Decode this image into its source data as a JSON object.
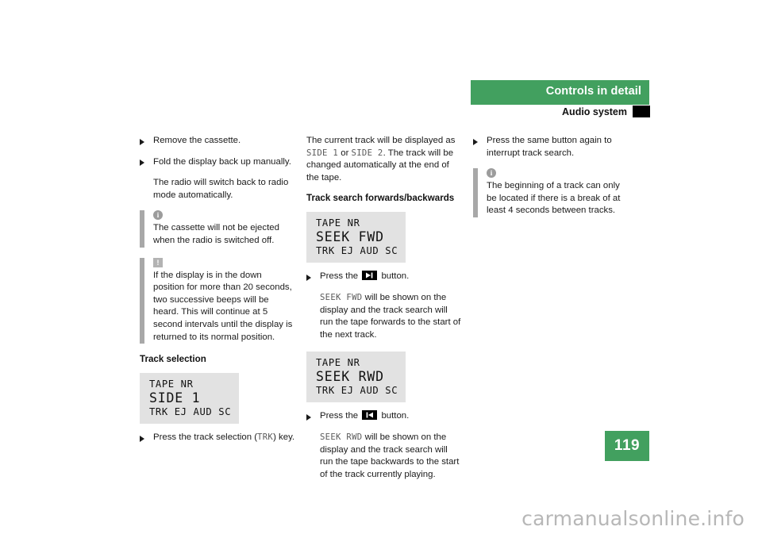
{
  "header": {
    "title": "Controls in detail",
    "subtitle": "Audio system",
    "band_color": "#42a05f",
    "tab_color": "#000000"
  },
  "page_number": "119",
  "watermark": "carmanualsonline.info",
  "columns": {
    "left": {
      "bullets": [
        "Remove the cassette.",
        "Fold the display back up manually."
      ],
      "indent_paragraph": "The radio will switch back to radio mode automatically.",
      "notes": [
        {
          "icon": "info-icon",
          "glyph": "i",
          "text": "The cassette will not be ejected when the radio is switched off."
        },
        {
          "icon": "warning-icon",
          "glyph": "!",
          "text": "If the display is in the down position for more than 20 seconds, two successive beeps will be heard. This will continue at 5 second intervals until the display is returned to its normal position."
        }
      ],
      "section_heading": "Track selection",
      "display": {
        "line1": "TAPE NR",
        "line2": "SIDE 1",
        "line3": "TRK EJ AUD SC"
      },
      "bullet_after_display": {
        "pre": "Press the track selection (",
        "mono": "TRK",
        "post": ") key."
      }
    },
    "middle": {
      "intro": {
        "part1": "The current track will be displayed as ",
        "mono1": "SIDE 1",
        "part2": " or ",
        "mono2": "SIDE 2",
        "part3": ". The track will be changed automatically at the end of the tape."
      },
      "section_heading": "Track search forwards/backwards",
      "fwd": {
        "display": {
          "line1": "TAPE NR",
          "line2": "SEEK FWD",
          "line3": "TRK EJ AUD SC"
        },
        "bullet_pre": "Press the ",
        "button_icon": "skip-forward-icon",
        "bullet_post": " button.",
        "body_mono": "SEEK FWD",
        "body_text": " will be shown on the display and the track search will run the tape forwards to the start of the next track."
      },
      "rwd": {
        "display": {
          "line1": "TAPE NR",
          "line2": "SEEK RWD",
          "line3": "TRK EJ AUD SC"
        },
        "bullet_pre": "Press the ",
        "button_icon": "skip-backward-icon",
        "bullet_post": " button.",
        "body_mono": "SEEK RWD",
        "body_text": " will be shown on the display and the track search will run the tape backwards to the start of the track currently playing."
      }
    },
    "right": {
      "bullet": "Press the same button again to interrupt track search.",
      "note": {
        "icon": "info-icon",
        "glyph": "i",
        "text": "The beginning of a track can only be located if there is a break of at least 4 seconds between tracks."
      }
    }
  }
}
